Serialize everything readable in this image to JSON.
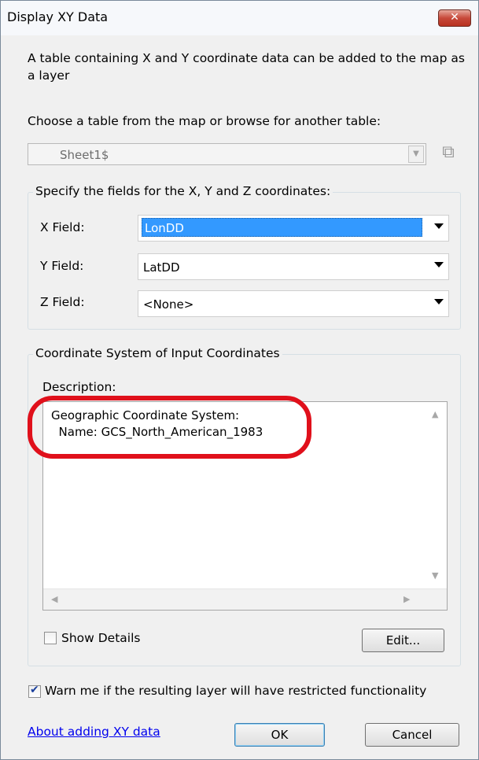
{
  "window": {
    "title": "Display XY Data",
    "close_glyph": "✕"
  },
  "intro_text": "A table containing X and Y coordinate data can be added to the map as a layer",
  "choose_label": "Choose a table from the map or browse for another table:",
  "table_combo": {
    "value": "Sheet1$",
    "arrow_icon": "chevron-down-icon",
    "browse_icon": "open-folder-icon"
  },
  "fields_group": {
    "label": "Specify the fields for the X, Y and Z coordinates:",
    "x": {
      "label": "X Field:",
      "value": "LonDD"
    },
    "y": {
      "label": "Y Field:",
      "value": "LatDD"
    },
    "z": {
      "label": "Z Field:",
      "value": "<None>"
    }
  },
  "coord_group": {
    "label": "Coordinate System of Input Coordinates",
    "description_label": "Description:",
    "description_lines": [
      "Geographic Coordinate System:",
      "  Name: GCS_North_American_1983"
    ],
    "show_details_label": "Show Details",
    "show_details_checked": false,
    "edit_button": "Edit..."
  },
  "warn": {
    "label": "Warn me if the resulting layer will have restricted functionality",
    "checked": true
  },
  "footer": {
    "link": "About adding XY data",
    "ok": "OK",
    "cancel": "Cancel"
  },
  "colors": {
    "selection": "#3399ff",
    "annotation_ellipse": "#e0101b",
    "link": "#0000ee"
  }
}
